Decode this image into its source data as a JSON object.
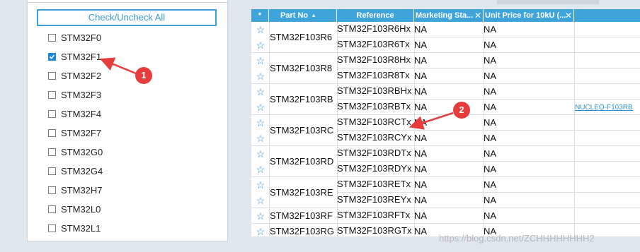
{
  "filter_panel": {
    "check_all_label": "Check/Uncheck All",
    "series": [
      {
        "label": "STM32F0",
        "checked": false
      },
      {
        "label": "STM32F1",
        "checked": true
      },
      {
        "label": "STM32F2",
        "checked": false
      },
      {
        "label": "STM32F3",
        "checked": false
      },
      {
        "label": "STM32F4",
        "checked": false
      },
      {
        "label": "STM32F7",
        "checked": false
      },
      {
        "label": "STM32G0",
        "checked": false
      },
      {
        "label": "STM32G4",
        "checked": false
      },
      {
        "label": "STM32H7",
        "checked": false
      },
      {
        "label": "STM32L0",
        "checked": false
      },
      {
        "label": "STM32L1",
        "checked": false
      }
    ]
  },
  "table": {
    "headers": {
      "star": "*",
      "part_no": "Part No",
      "reference": "Reference",
      "marketing_status": "Marketing Sta...",
      "unit_price": "Unit Price for 10kU (..."
    },
    "parts": [
      {
        "part": "STM32F103R6",
        "refs": [
          "STM32F103R6Hx",
          "STM32F103R6Tx"
        ],
        "board": ""
      },
      {
        "part": "STM32F103R8",
        "refs": [
          "STM32F103R8Hx",
          "STM32F103R8Tx"
        ],
        "board": ""
      },
      {
        "part": "STM32F103RB",
        "refs": [
          "STM32F103RBHx",
          "STM32F103RBTx"
        ],
        "board": "NUCLEO-F103RB"
      },
      {
        "part": "STM32F103RC",
        "refs": [
          "STM32F103RCTx",
          "STM32F103RCYx"
        ],
        "board": ""
      },
      {
        "part": "STM32F103RD",
        "refs": [
          "STM32F103RDTx",
          "STM32F103RDYx"
        ],
        "board": ""
      },
      {
        "part": "STM32F103RE",
        "refs": [
          "STM32F103RETx",
          "STM32F103REYx"
        ],
        "board": ""
      },
      {
        "part": "STM32F103RF",
        "refs": [
          "STM32F103RFTx"
        ],
        "board": ""
      },
      {
        "part": "STM32F103RG",
        "refs": [
          "STM32F103RGTx"
        ],
        "board": ""
      }
    ],
    "marketing_value": "NA",
    "price_value": "NA"
  },
  "annotations": {
    "badge1": "1",
    "badge2": "2"
  },
  "watermark": "https://blog.csdn.net/ZCHHHHHHHH2",
  "colors": {
    "header_bg": "#3ea4d9",
    "accent": "#1e88d6",
    "badge": "#e83b3b",
    "star": "#2e8fd1"
  }
}
